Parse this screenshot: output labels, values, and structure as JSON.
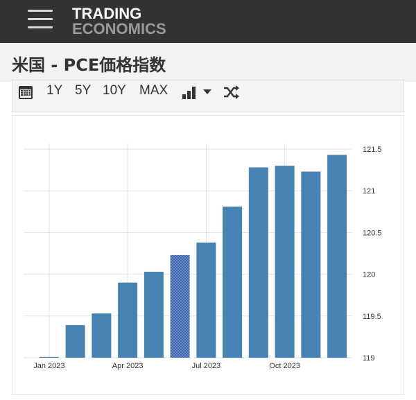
{
  "header": {
    "logo_line1": "TRADING",
    "logo_line2": "ECONOMICS"
  },
  "page": {
    "title": "米国 - PCE価格指数"
  },
  "toolbar": {
    "range_1y": "1Y",
    "range_5y": "5Y",
    "range_10y": "10Y",
    "range_max": "MAX",
    "icons": [
      "calendar-icon",
      "bar-chart-icon",
      "caret-down-icon",
      "shuffle-icon"
    ]
  },
  "colors": {
    "bar": "#4682b4",
    "bar_highlight": "#3f67ad",
    "topbar": "#333333"
  },
  "chart_data": {
    "type": "bar",
    "title": "",
    "xlabel": "",
    "ylabel": "",
    "x": [
      "2023-01",
      "2023-02",
      "2023-03",
      "2023-04",
      "2023-05",
      "2023-06",
      "2023-07",
      "2023-08",
      "2023-09",
      "2023-10",
      "2023-11",
      "2023-12"
    ],
    "values": [
      119.01,
      119.39,
      119.53,
      119.9,
      120.03,
      120.23,
      120.38,
      120.81,
      121.28,
      121.3,
      121.23,
      121.43
    ],
    "highlight_index": 5,
    "x_tick_labels": [
      {
        "label": "Jan 2023",
        "x": "2023-01"
      },
      {
        "label": "Apr 2023",
        "x": "2023-04"
      },
      {
        "label": "Jul 2023",
        "x": "2023-07"
      },
      {
        "label": "Oct 2023",
        "x": "2023-10"
      }
    ],
    "y_ticks": [
      119,
      119.5,
      120,
      120.5,
      121,
      121.5
    ],
    "y_tick_labels": [
      "119",
      "119.5",
      "120",
      "120.5",
      "121",
      "121.5"
    ],
    "ylim": [
      119,
      121.5
    ],
    "y_axis_side": "right",
    "grid": true
  }
}
